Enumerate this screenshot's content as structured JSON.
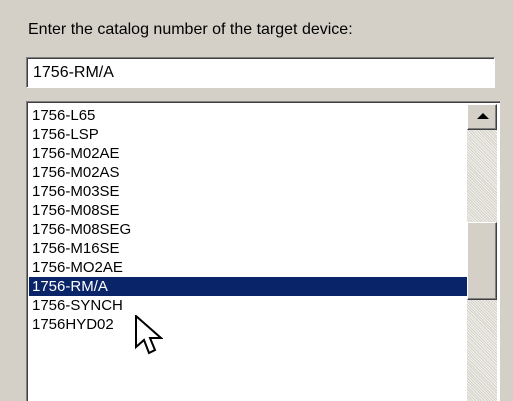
{
  "prompt": {
    "label": "Enter the catalog number of the target device:"
  },
  "catalog_input": {
    "value": "1756-RM/A"
  },
  "device_list": {
    "items": [
      "1756-L65",
      "1756-LSP",
      "1756-M02AE",
      "1756-M02AS",
      "1756-M03SE",
      "1756-M08SE",
      "1756-M08SEG",
      "1756-M16SE",
      "1756-MO2AE",
      "1756-RM/A",
      "1756-SYNCH",
      "1756HYD02"
    ],
    "selected": "1756-RM/A",
    "selection_color": "#0a246a",
    "scrollbar": {
      "up_icon": "triangle-up-icon"
    }
  },
  "cursor": {
    "icon": "arrow-pointer-icon"
  }
}
